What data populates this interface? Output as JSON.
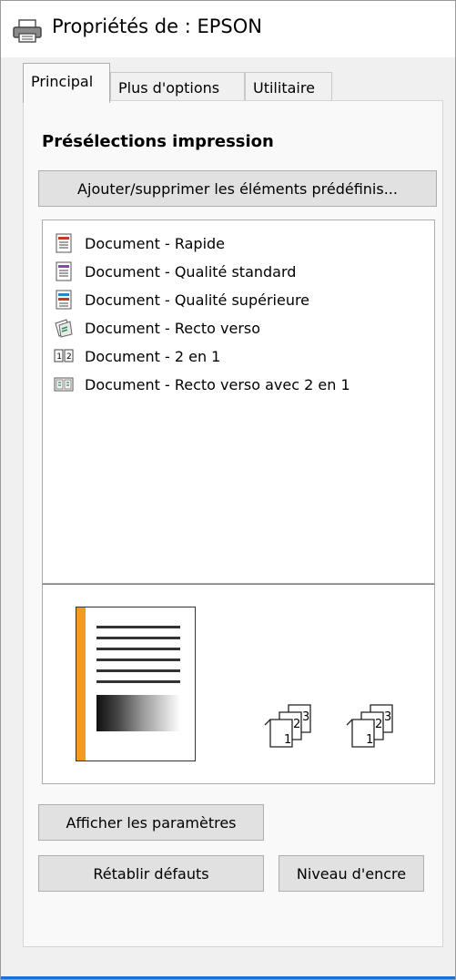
{
  "window": {
    "title": "Propriétés de : EPSON"
  },
  "tabs": [
    {
      "label": "Principal",
      "active": true
    },
    {
      "label": "Plus d'options",
      "active": false
    },
    {
      "label": "Utilitaire",
      "active": false
    }
  ],
  "presets": {
    "section_title": "Présélections impression",
    "add_remove_button": "Ajouter/supprimer les éléments prédéfinis...",
    "items": [
      {
        "label": "Document - Rapide",
        "icon": "document-fast-icon"
      },
      {
        "label": "Document - Qualité standard",
        "icon": "document-standard-icon"
      },
      {
        "label": "Document - Qualité supérieure",
        "icon": "document-high-quality-icon"
      },
      {
        "label": "Document - Recto verso",
        "icon": "document-duplex-icon"
      },
      {
        "label": "Document - 2 en 1",
        "icon": "document-2up-icon"
      },
      {
        "label": "Document - Recto verso avec 2 en 1",
        "icon": "document-duplex-2up-icon"
      }
    ]
  },
  "preview": {
    "accent_color": "#f39a1f",
    "stack1_numbers": [
      "1",
      "2",
      "3"
    ],
    "stack2_numbers": [
      "1",
      "2",
      "3"
    ]
  },
  "buttons": {
    "show_settings": "Afficher les paramètres",
    "restore_defaults": "Rétablir défauts",
    "ink_levels": "Niveau d'encre"
  }
}
